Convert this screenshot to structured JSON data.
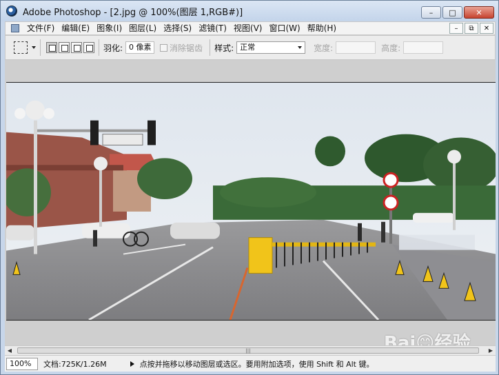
{
  "window": {
    "title": "Adobe Photoshop - [2.jpg @ 100%(图层 1,RGB#)]",
    "minimize_glyph": "–",
    "maximize_glyph": "□",
    "close_glyph": "✕"
  },
  "menu": {
    "items": [
      "文件(F)",
      "编辑(E)",
      "图象(I)",
      "图层(L)",
      "选择(S)",
      "滤镜(T)",
      "视图(V)",
      "窗口(W)",
      "帮助(H)"
    ],
    "doc_buttons": [
      "–",
      "⧉",
      "✕"
    ]
  },
  "options": {
    "feather_label": "羽化:",
    "feather_value": "0 像素",
    "antialias_label": "消除锯齿",
    "style_label": "样式:",
    "style_value": "正常",
    "width_label": "宽度:",
    "height_label": "高度:"
  },
  "statusbar": {
    "zoom": "100%",
    "doc_info": "文档:725K/1.26M",
    "hint": "点按并拖移以移动图层或选区。要用附加选项，使用 Shift 和 Alt 键。"
  },
  "scrollbar": {
    "thumb_grip": "|||"
  },
  "watermark": "Bai😊经验",
  "icons": {
    "app": "photoshop-eye-icon",
    "marquee": "rectangular-marquee-icon"
  },
  "colors": {
    "titlebar": "#c7d6ea",
    "close_button": "#c7432f"
  }
}
